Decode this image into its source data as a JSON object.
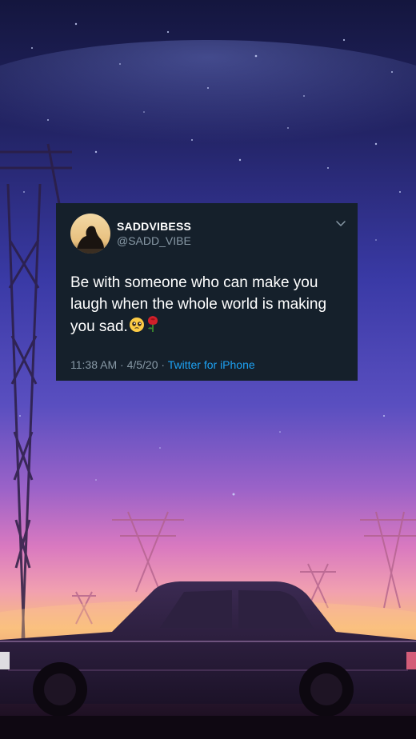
{
  "tweet": {
    "display_name": "SADDVIBESS",
    "handle": "@SADD_VIBE",
    "text": "Be with someone who can make you laugh when the whole world is making you sad.",
    "emojis": [
      "pleading-face-emoji",
      "rose-emoji"
    ],
    "time": "11:38 AM",
    "separator_1": " · ",
    "date": "4/5/20",
    "separator_2": " · ",
    "source": "Twitter for iPhone"
  },
  "colors": {
    "card_background": "#15202b",
    "text_primary": "#ffffff",
    "text_secondary": "#8899a6",
    "link": "#1da1f2",
    "sky_top": "#161845",
    "sky_mid": "#3c3aa8",
    "sky_pink": "#e07ac0",
    "horizon_orange": "#f6b36a"
  },
  "icons": {
    "menu": "chevron-down-icon"
  }
}
